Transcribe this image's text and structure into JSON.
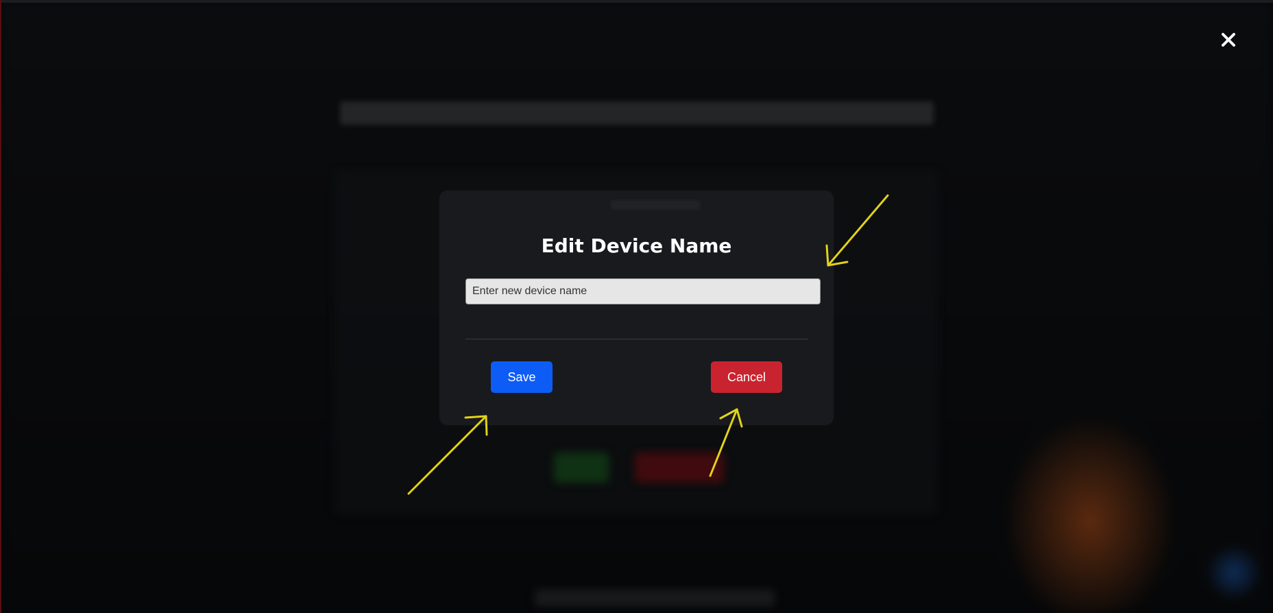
{
  "overlay": {
    "close_icon": "close-icon"
  },
  "modal": {
    "title": "Edit Device Name",
    "input": {
      "value": "",
      "placeholder": "Enter new device name"
    },
    "save_label": "Save",
    "cancel_label": "Cancel"
  },
  "colors": {
    "save": "#0d5cf6",
    "cancel": "#c9232f",
    "annotation_arrow": "#e3d21a",
    "modal_bg": "#181a1d"
  },
  "annotations": {
    "arrow_icon": "annotation-arrow-icon",
    "count": 3
  }
}
